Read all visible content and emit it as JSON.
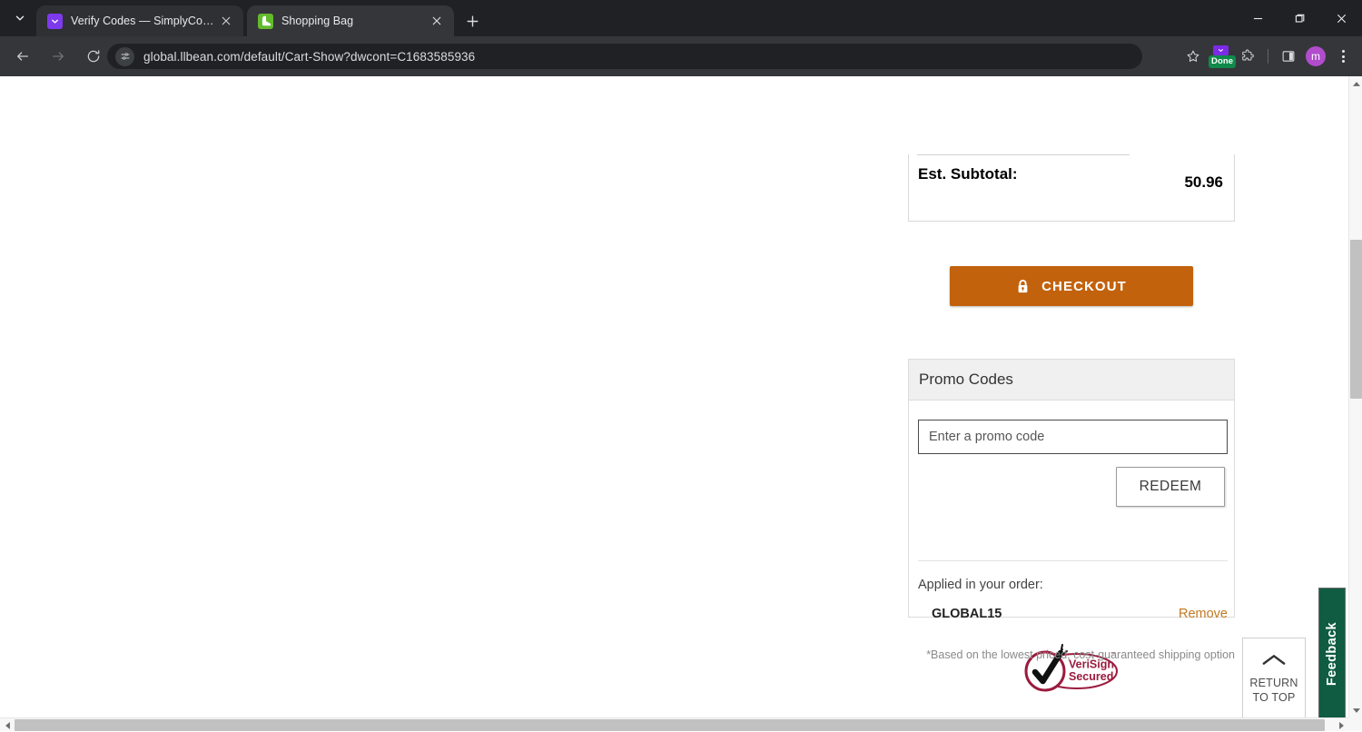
{
  "browser": {
    "tabs": [
      {
        "title": "Verify Codes — SimplyCodes",
        "favicon": "simplycodes-chevron-icon",
        "active": false
      },
      {
        "title": "Shopping Bag",
        "favicon": "llbean-boot-icon",
        "active": true
      }
    ],
    "new_tab_label": "+",
    "window_controls": [
      "minimize",
      "maximize",
      "close"
    ],
    "nav": {
      "back": "back-icon",
      "forward": "forward-icon",
      "reload": "reload-icon"
    },
    "omnibox": {
      "site_icon": "page-settings-icon",
      "url": "global.llbean.com/default/Cart-Show?dwcont=C1683585936"
    },
    "toolbar_right": {
      "bookmark": "star-icon",
      "extension_badge": "Done",
      "extensions": "puzzle-piece-icon",
      "side_panel": "side-panel-icon",
      "profile_initial": "m",
      "menu": "kebab-menu-icon"
    }
  },
  "page": {
    "subtotal": {
      "label": "Est. Subtotal:",
      "value": "50.96"
    },
    "checkout": {
      "label": "CHECKOUT",
      "icon": "lock-icon",
      "color": "#c2620d"
    },
    "promo": {
      "heading": "Promo Codes",
      "input_value": "",
      "input_placeholder": "Enter a promo code",
      "redeem_label": "REDEEM",
      "applied_label": "Applied in your order:",
      "applied_code": "GLOBAL15",
      "remove_label": "Remove",
      "remove_color": "#c2781f"
    },
    "trust_badge": {
      "icon": "verisign-secured-icon",
      "line1": "VeriSign",
      "line2": "Secured",
      "tm": "™"
    },
    "footnote": "*Based on the lowest priced, cost-guaranteed shipping option",
    "return_to_top": {
      "icon": "chevron-up-icon",
      "line1": "RETURN",
      "line2": "TO TOP"
    },
    "feedback_tab": {
      "label": "Feedback",
      "color": "#0f5c43"
    }
  },
  "scrollbars": {
    "vertical": {
      "up_arrow": "caret-up-icon",
      "down_arrow": "caret-down-icon"
    },
    "horizontal": {
      "left_arrow": "caret-left-icon",
      "right_arrow": "caret-right-icon"
    }
  }
}
